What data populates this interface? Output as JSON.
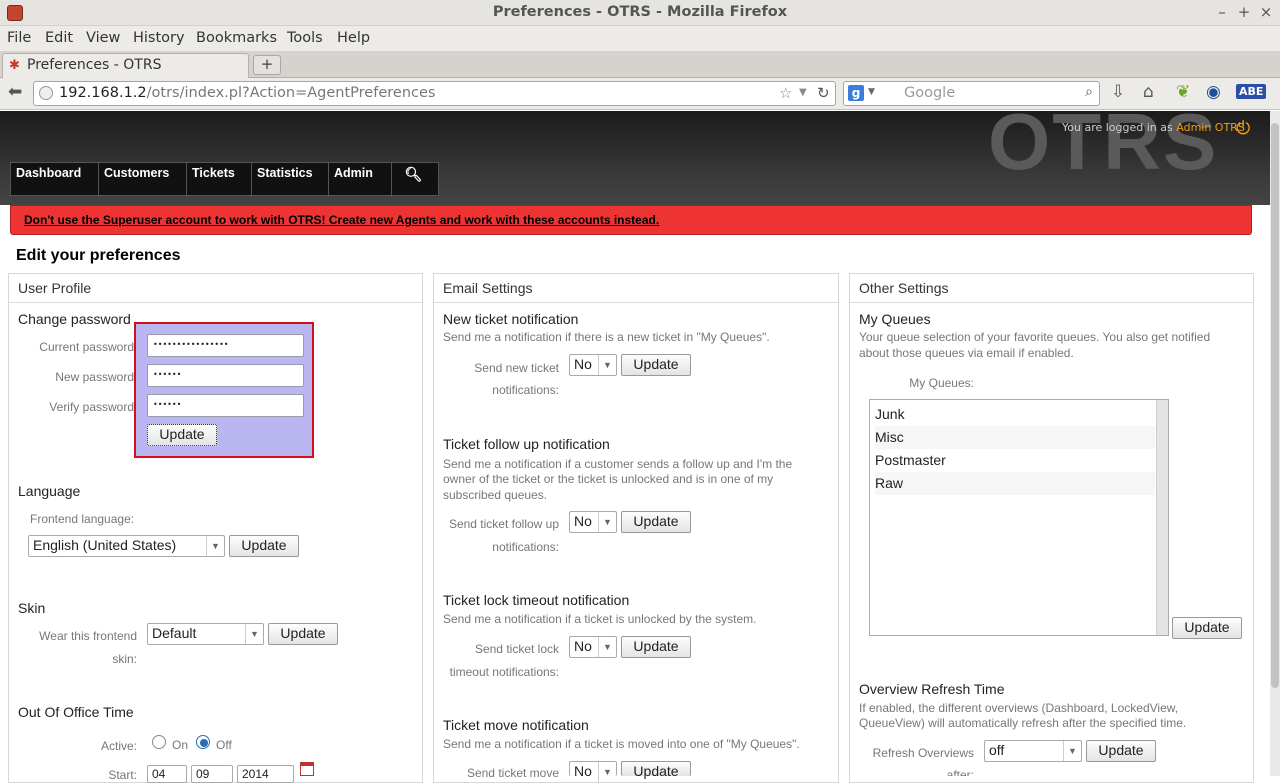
{
  "window": {
    "title": "Preferences - OTRS - Mozilla Firefox",
    "controls": [
      "–",
      "+",
      "×"
    ]
  },
  "menu": [
    "File",
    "Edit",
    "View",
    "History",
    "Bookmarks",
    "Tools",
    "Help"
  ],
  "tab": {
    "label": "Preferences - OTRS",
    "new_tab": "+"
  },
  "nav": {
    "url_host": "192.168.1.2",
    "url_path": "/otrs/index.pl?Action=AgentPreferences",
    "search_placeholder": "Google"
  },
  "header": {
    "logo": "OTRS",
    "logged_in_text": "You are logged in as",
    "user": "Admin OTRS"
  },
  "mainnav": [
    "Dashboard",
    "Customers",
    "Tickets",
    "Statistics",
    "Admin"
  ],
  "warning": "Don't use the Superuser account to work with OTRS! Create new Agents and work with these accounts instead.",
  "page_title": "Edit your preferences",
  "user_profile": {
    "title": "User Profile",
    "password": {
      "title": "Change password",
      "current_label": "Current password",
      "current_value": "••••••••••••••••",
      "new_label": "New password",
      "new_value": "••••••",
      "verify_label": "Verify password",
      "verify_value": "••••••",
      "button": "Update"
    },
    "language": {
      "title": "Language",
      "label": "Frontend language:",
      "value": "English (United States)",
      "button": "Update"
    },
    "skin": {
      "title": "Skin",
      "label_1": "Wear this frontend",
      "label_2": "skin:",
      "value": "Default",
      "button": "Update"
    },
    "out_of_office": {
      "title": "Out Of Office Time",
      "active_label": "Active:",
      "on_label": "On",
      "off_label": "Off",
      "start_label": "Start:",
      "start_day": "04",
      "start_month": "09",
      "start_year": "2014"
    }
  },
  "email_settings": {
    "title": "Email Settings",
    "new_ticket": {
      "title": "New ticket notification",
      "desc": "Send me a notification if there is a new ticket in \"My Queues\".",
      "label_1": "Send new ticket",
      "label_2": "notifications:",
      "value": "No",
      "button": "Update"
    },
    "follow_up": {
      "title": "Ticket follow up notification",
      "desc_1": "Send me a notification if a customer sends a follow up and I'm the",
      "desc_2": "owner of the ticket or the ticket is unlocked and is in one of my",
      "desc_3": "subscribed queues.",
      "label_1": "Send ticket follow up",
      "label_2": "notifications:",
      "value": "No",
      "button": "Update"
    },
    "lock_timeout": {
      "title": "Ticket lock timeout notification",
      "desc": "Send me a notification if a ticket is unlocked by the system.",
      "label_1": "Send ticket lock",
      "label_2": "timeout notifications:",
      "value": "No",
      "button": "Update"
    },
    "move": {
      "title": "Ticket move notification",
      "desc": "Send me a notification if a ticket is moved into one of \"My Queues\".",
      "label_1": "Send ticket move",
      "value": "No",
      "button": "Update"
    }
  },
  "other_settings": {
    "title": "Other Settings",
    "my_queues": {
      "title": "My Queues",
      "desc_1": "Your queue selection of your favorite queues. You also get notified",
      "desc_2": "about those queues via email if enabled.",
      "label": "My Queues:",
      "items": [
        "Junk",
        "Misc",
        "Postmaster",
        "Raw"
      ],
      "button": "Update"
    },
    "refresh": {
      "title": "Overview Refresh Time",
      "desc_1": "If enabled, the different overviews (Dashboard, LockedView,",
      "desc_2": "QueueView) will automatically refresh after the specified time.",
      "label_1": "Refresh Overviews",
      "label_2": "after:",
      "value": "off",
      "button": "Update"
    }
  },
  "colors": {
    "accent": "#f39c12",
    "warning_bg": "#ee3333",
    "highlight": "#b9b6f1",
    "highlight_border": "#d0101a"
  }
}
